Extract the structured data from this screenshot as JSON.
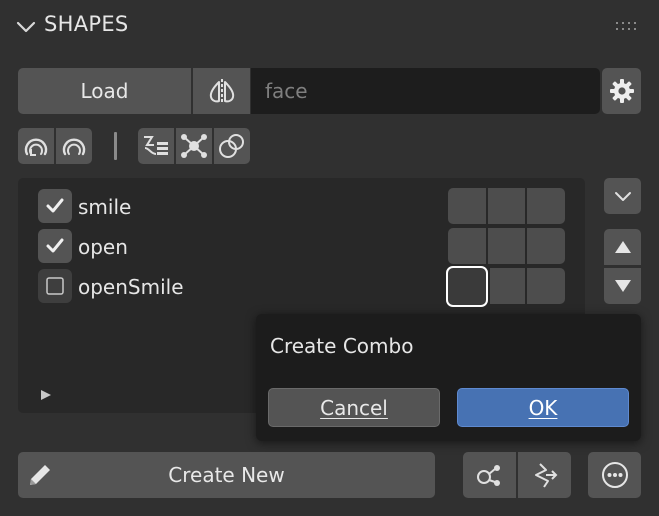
{
  "panel": {
    "title": "SHAPES",
    "collapse_icon": "chevron-down-icon",
    "grip_icon": "drag-grip-icon"
  },
  "toolbar": {
    "load_label": "Load",
    "mirror_icon": "mirror-icon",
    "name_placeholder": "face",
    "settings_icon": "gear-icon"
  },
  "tools": [
    {
      "icon": "arc-left-icon"
    },
    {
      "icon": "arc-right-icon"
    },
    {
      "icon": "driver-list-icon"
    },
    {
      "icon": "node-connect-icon"
    },
    {
      "icon": "overlap-circles-icon"
    }
  ],
  "shapes": [
    {
      "name": "smile",
      "checked": true
    },
    {
      "name": "open",
      "checked": true
    },
    {
      "name": "openSmile",
      "checked": false
    }
  ],
  "dialog": {
    "title": "Create Combo",
    "cancel_label": "Cancel",
    "ok_label": "OK"
  },
  "bottom": {
    "create_label": "Create New",
    "edit_icon": "pencil-icon",
    "combo_icon": "share-nodes-icon",
    "split_icon": "branch-icon",
    "more_icon": "ellipsis-circle-icon"
  },
  "colors": {
    "background": "#303030",
    "button": "#545454",
    "field": "#1d1d1d",
    "list_bg": "#282828",
    "accent": "#4772b3"
  }
}
